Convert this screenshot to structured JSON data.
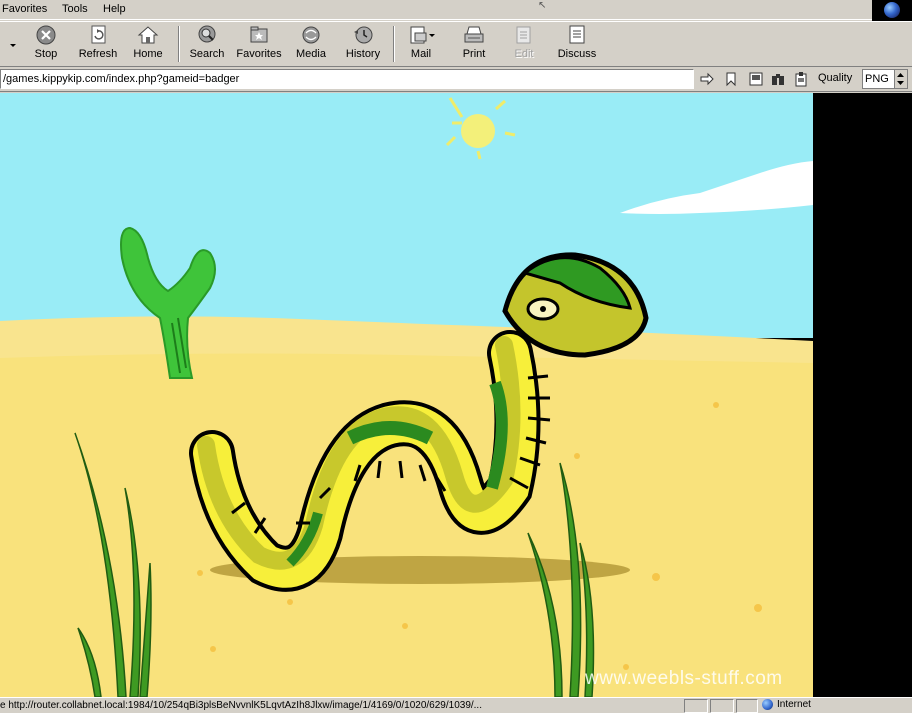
{
  "menubar": {
    "items": [
      "Favorites",
      "Tools",
      "Help"
    ]
  },
  "toolbar": {
    "buttons": [
      {
        "label": "Stop",
        "icon": "stop-icon"
      },
      {
        "label": "Refresh",
        "icon": "refresh-icon"
      },
      {
        "label": "Home",
        "icon": "home-icon"
      },
      {
        "label": "Search",
        "icon": "search-icon"
      },
      {
        "label": "Favorites",
        "icon": "favorites-icon"
      },
      {
        "label": "Media",
        "icon": "media-icon"
      },
      {
        "label": "History",
        "icon": "history-icon"
      },
      {
        "label": "Mail",
        "icon": "mail-icon"
      },
      {
        "label": "Print",
        "icon": "print-icon"
      },
      {
        "label": "Edit",
        "icon": "edit-icon",
        "disabled": true
      },
      {
        "label": "Discuss",
        "icon": "discuss-icon"
      }
    ]
  },
  "address": {
    "url": "/games.kippykip.com/index.php?gameid=badger",
    "quality_label": "Quality",
    "quality_value": "PNG"
  },
  "game": {
    "watermark": "www.weebls-stuff.com"
  },
  "status": {
    "text": "e http://router.collabnet.local:1984/10/254qBi3plsBeNvvnlK5LqvtAzIh8Jlxw/image/1/4169/0/1020/629/1039/...",
    "zone": "Internet"
  }
}
